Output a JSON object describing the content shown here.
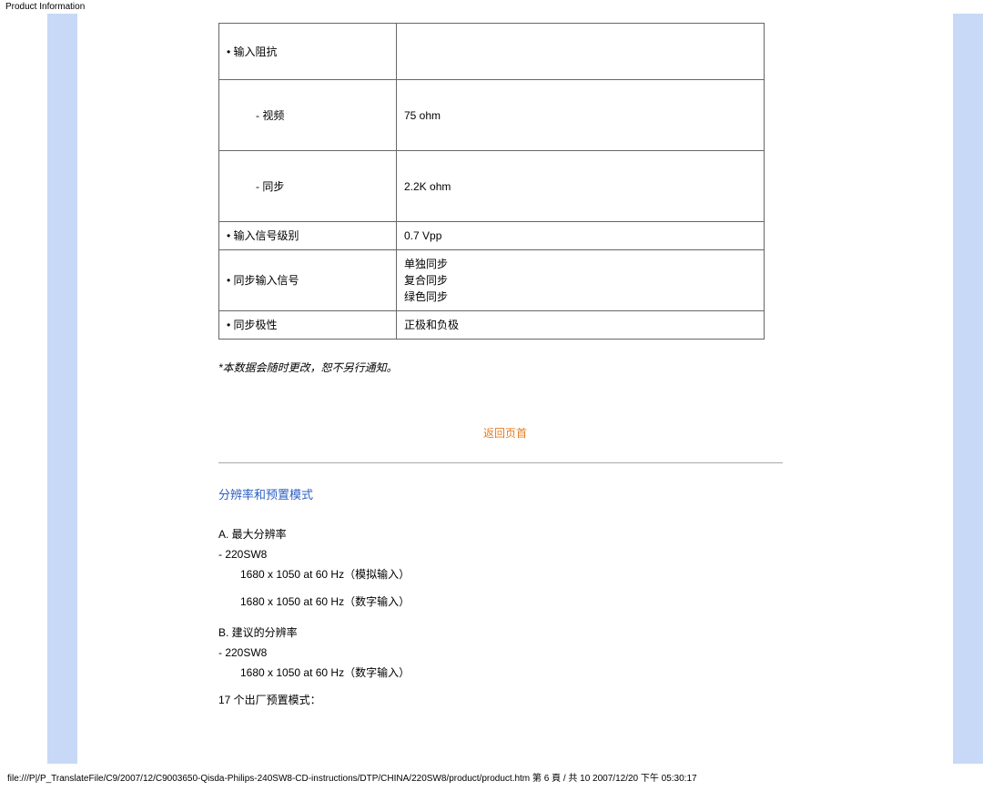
{
  "header_label": "Product Information",
  "table": {
    "r1c1": "• 输入阻抗",
    "r2c1": "- 视频",
    "r2c2": "75 ohm",
    "r3c1": "- 同步",
    "r3c2": "2.2K ohm",
    "r4c1": "• 输入信号级别",
    "r4c2": "0.7 Vpp",
    "r5c1": "• 同步输入信号",
    "r5c2a": "单独同步",
    "r5c2b": "复合同步",
    "r5c2c": "绿色同步",
    "r6c1": "• 同步极性",
    "r6c2": "正极和负极"
  },
  "note": "*本数据会随时更改，恕不另行通知。",
  "back_to_top": "返回页首",
  "section_title": "分辨率和预置模式",
  "res": {
    "a_label": "A.  最大分辨率",
    "a_model": "-    220SW8",
    "a_line1": "1680 x 1050 at 60 Hz（模拟输入）",
    "a_line2": "1680 x 1050 at 60 Hz（数字输入）",
    "b_label": "B.  建议的分辨率",
    "b_model": "-    220SW8",
    "b_line1": "1680 x 1050 at 60 Hz（数字输入）",
    "factory_modes": "17 个出厂预置模式："
  },
  "footer": "file:///P|/P_TranslateFile/C9/2007/12/C9003650-Qisda-Philips-240SW8-CD-instructions/DTP/CHINA/220SW8/product/product.htm 第 6 頁 / 共 10 2007/12/20 下午 05:30:17"
}
